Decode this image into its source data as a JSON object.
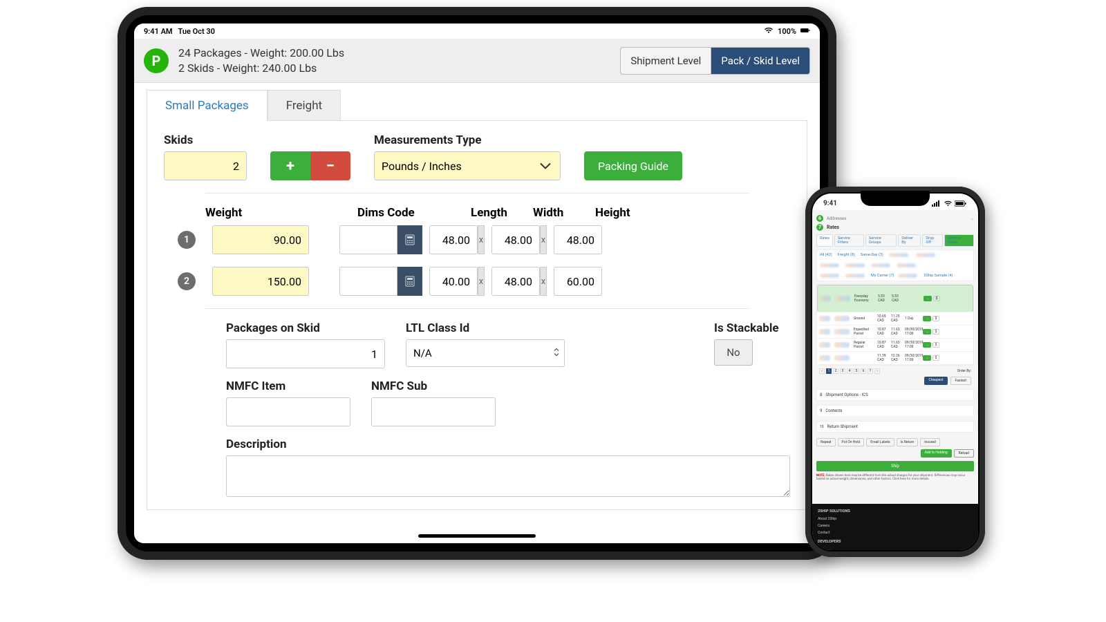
{
  "ipad": {
    "status_time": "9:41 AM",
    "status_date": "Tue Oct 30",
    "battery": "100%",
    "avatar_letter": "P",
    "summary_line1": "24 Packages - Weight: 200.00 Lbs",
    "summary_line2": "2 Skids - Weight: 240.00 Lbs",
    "btn_shipment_level": "Shipment Level",
    "btn_pack_skid_level": "Pack / Skid Level",
    "tabs": {
      "small_packages": "Small Packages",
      "freight": "Freight"
    },
    "skids_label": "Skids",
    "skids_value": "2",
    "plus": "+",
    "minus": "−",
    "measurements_label": "Measurements Type",
    "measurements_value": "Pounds / Inches",
    "packing_guide": "Packing Guide",
    "col_weight": "Weight",
    "col_dims": "Dims Code",
    "col_length": "Length",
    "col_width": "Width",
    "col_height": "Height",
    "x_label": "x",
    "rows": [
      {
        "n": "1",
        "weight": "90.00",
        "dims": "",
        "l": "48.00",
        "w": "48.00",
        "h": "48.00"
      },
      {
        "n": "2",
        "weight": "150.00",
        "dims": "",
        "l": "40.00",
        "w": "48.00",
        "h": "60.00"
      }
    ],
    "packages_on_skid_label": "Packages on Skid",
    "packages_on_skid_value": "1",
    "ltl_label": "LTL Class Id",
    "ltl_value": "N/A",
    "stackable_label": "Is Stackable",
    "stackable_value": "No",
    "nmfc_item_label": "NMFC Item",
    "nmfc_sub_label": "NMFC Sub",
    "description_label": "Description"
  },
  "iphone": {
    "time": "9:41",
    "step_addresses": "Addresses",
    "step_rates": "Rates",
    "tabs": [
      "Rates",
      "Service Filters",
      "Service Groups",
      "Deliver By",
      "Drop Off"
    ],
    "refresh_rates": "Refresh Rates",
    "filters": [
      "All (42)",
      "Freight (8)",
      "Same-Day (3)"
    ],
    "carrier_row": [
      "My Carrier (7)",
      "2Ship Sample (4)"
    ],
    "rates": [
      {
        "svc": "Everyday Economy",
        "p1": "5.53 CAD",
        "p2": "5.53 CAD",
        "eta": "",
        "selected": true
      },
      {
        "svc": "Ground",
        "p1": "10.69 CAD",
        "p2": "11.25 CAD",
        "eta": "1 Day",
        "selected": false
      },
      {
        "svc": "Expedited Parcel",
        "p1": "10.87 CAD",
        "p2": "11.63 CAD",
        "eta": "09/30/2019 17:00",
        "selected": false
      },
      {
        "svc": "Regular Parcel",
        "p1": "10.87 CAD",
        "p2": "11.63 CAD",
        "eta": "09/30/2019 17:00",
        "selected": false
      },
      {
        "svc": "",
        "p1": "11.39 CAD",
        "p2": "12.26 CAD",
        "eta": "09/30/2019 17:00",
        "selected": false
      }
    ],
    "order_by_label": "Order By:",
    "order_cheapest": "Cheapest",
    "order_fastest": "Fastest",
    "accordion": [
      "Shipment Options - ICS",
      "Contents",
      "Return Shipment"
    ],
    "actions": [
      "Repeat",
      "Put On Hold",
      "Email Labels",
      "Is Return",
      "Insured"
    ],
    "add_to_holding": "Add to Holding",
    "reload": "Reload",
    "ship": "Ship",
    "note_prefix": "NOTE:",
    "note_body": "Rates shown here may be different from the actual charges for your shipment. Differences may occur based on actual weight, dimensions, and other factors. Click here for more details.",
    "footer_heading": "2SHIP SOLUTIONS",
    "footer_links": [
      "About 2Ship",
      "Careers",
      "Contact"
    ],
    "footer_dev": "DEVELOPERS"
  }
}
